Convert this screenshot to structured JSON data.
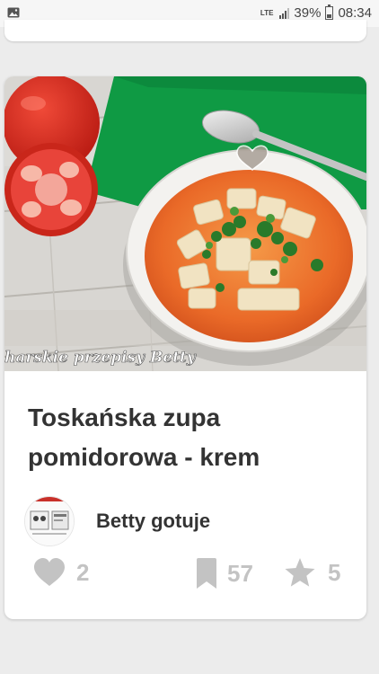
{
  "status_bar": {
    "network": "LTE",
    "battery": "39%",
    "time": "08:34"
  },
  "recipe": {
    "title": "Toskańska zupa pomidorowa - krem",
    "watermark": "harskie przepisy Betty",
    "author": "Betty gotuje",
    "likes": "2",
    "saves": "57",
    "rating": "5"
  },
  "icons": {
    "gallery": "image-icon",
    "favorite": "heart-outline-icon",
    "like": "heart-icon",
    "save": "bookmark-icon",
    "rating": "star-icon"
  },
  "colors": {
    "text": "#333333",
    "stat_gray": "#c3c3c3",
    "background": "#ececec"
  }
}
